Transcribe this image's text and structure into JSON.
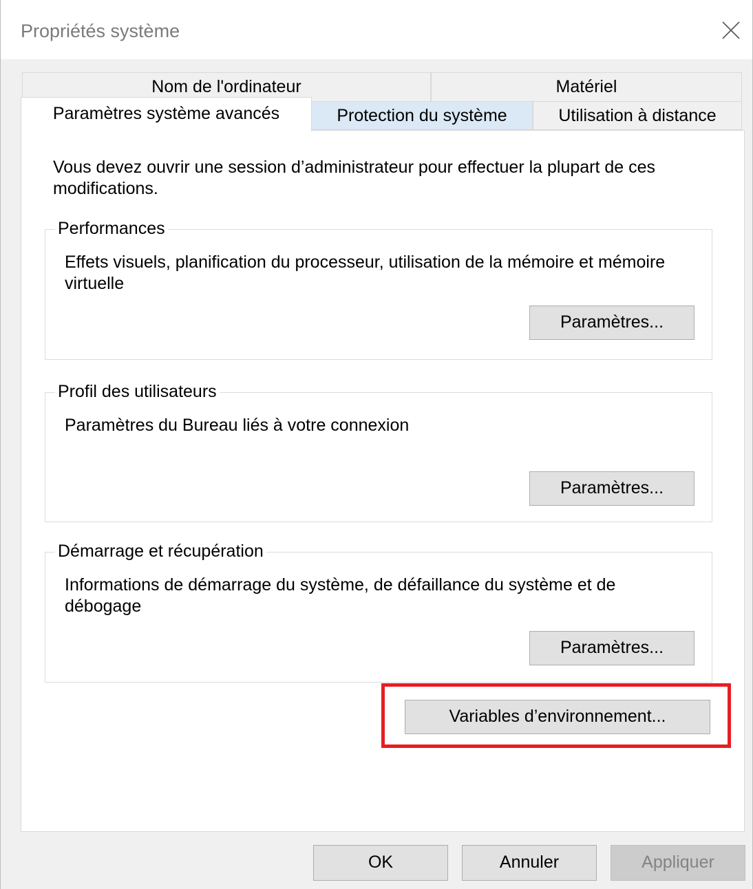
{
  "window": {
    "title": "Propriétés système"
  },
  "tabs": {
    "computer_name": "Nom de l'ordinateur",
    "hardware": "Matériel",
    "advanced": "Paramètres système avancés",
    "protection": "Protection du système",
    "remote": "Utilisation à distance"
  },
  "panel": {
    "intro": "Vous devez ouvrir une session d’administrateur pour effectuer la plupart de ces modifications.",
    "performance": {
      "legend": "Performances",
      "description": "Effets visuels, planification du processeur, utilisation de la mémoire et mémoire virtuelle",
      "button": "Paramètres..."
    },
    "user_profiles": {
      "legend": "Profil des utilisateurs",
      "description": "Paramètres du Bureau liés à votre connexion",
      "button": "Paramètres..."
    },
    "startup_recovery": {
      "legend": "Démarrage et récupération",
      "description": "Informations de démarrage du système, de défaillance du système et de débogage",
      "button": "Paramètres..."
    },
    "env_vars_button": "Variables d’environnement..."
  },
  "footer": {
    "ok": "OK",
    "cancel": "Annuler",
    "apply": "Appliquer"
  },
  "colors": {
    "highlight": "#e81d23",
    "protection_tab_bg": "#dbe8f5",
    "apply_disabled_text": "#838383"
  },
  "icons": {
    "close": "close-icon"
  }
}
